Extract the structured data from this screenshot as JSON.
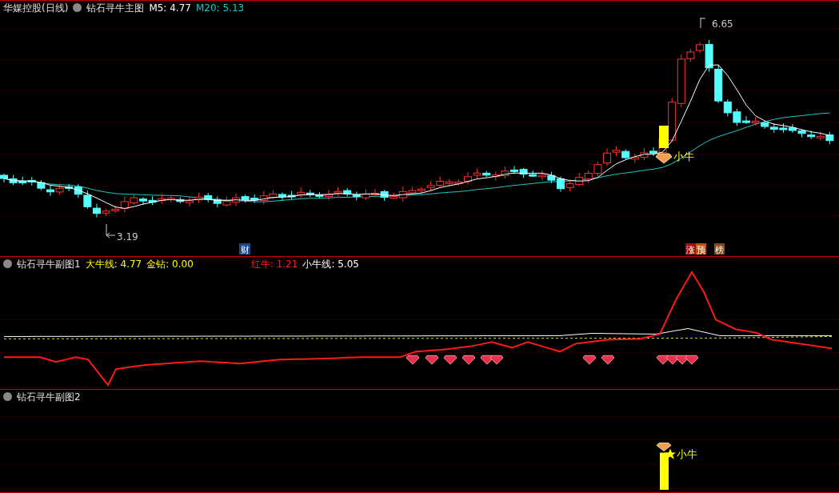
{
  "main": {
    "stock": "华媒控股(日线)",
    "indicator": "钻石寻牛主图",
    "lines": [
      {
        "text": "M5: 4.77",
        "color": "#ffffff"
      },
      {
        "text": "M20: 5.13",
        "color": "#1ec8c8"
      }
    ],
    "high_label": "6.65",
    "low_label": "3.19",
    "signal_label": "小牛",
    "markers": [
      {
        "text": "财",
        "color": "#1e4a8c"
      }
    ],
    "badges": [
      {
        "text": "涨",
        "color": "#a01010"
      },
      {
        "text": "预",
        "color": "#c0500e"
      },
      {
        "text": "榜",
        "color": "#8a4a12"
      }
    ]
  },
  "sub1": {
    "indicator": "钻石寻牛副图1",
    "lines": [
      {
        "text": "大牛线: 4.77",
        "color": "#ffff00"
      },
      {
        "text": "金钻: 0.00",
        "color": "#ffff00"
      }
    ],
    "more_lines": [
      {
        "text": "红牛: 1.21",
        "color": "#ff2020"
      },
      {
        "text": "小牛线: 5.05",
        "color": "#ffffff"
      }
    ]
  },
  "sub2": {
    "indicator": "钻石寻牛副图2",
    "signal_label": "小牛"
  }
}
